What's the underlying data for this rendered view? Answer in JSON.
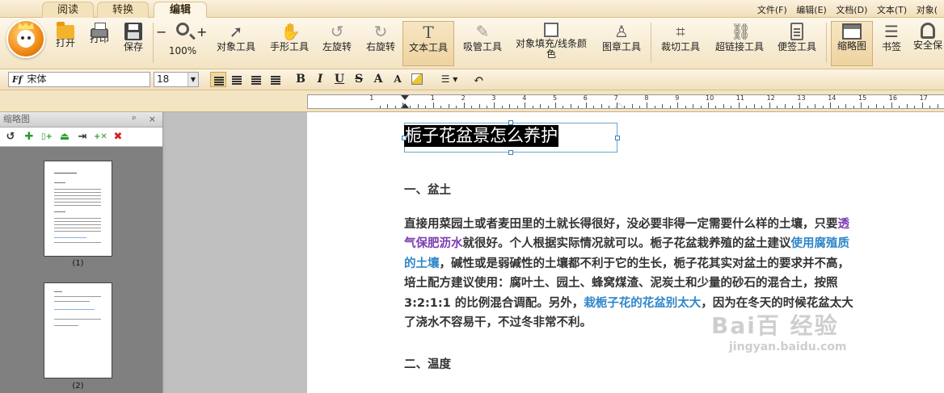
{
  "tabs": [
    {
      "label": "阅读"
    },
    {
      "label": "转换"
    },
    {
      "label": "编辑"
    }
  ],
  "menus": [
    "文件(F)",
    "编辑(E)",
    "文档(D)",
    "文本(T)",
    "对象("
  ],
  "ribbon": {
    "open": "打开",
    "print": "打印",
    "save": "保存",
    "zoom_minus": "−",
    "zoom_plus": "+",
    "zoom_level": "100%",
    "object_tool": "对象工具",
    "hand_tool": "手形工具",
    "rotate_left": "左旋转",
    "rotate_right": "右旋转",
    "text_tool": "文本工具",
    "eyedropper": "吸管工具",
    "fill_color": "对象填充/线条颜色",
    "stamp_tool": "图章工具",
    "crop_tool": "裁切工具",
    "link_tool": "超链接工具",
    "note_tool": "便签工具",
    "thumbnails": "缩略图",
    "bookmarks": "书签",
    "security": "安全保"
  },
  "format": {
    "font_prefix": "Ff",
    "font_name": "宋体",
    "font_size": "18",
    "bold": "B",
    "italic": "I",
    "underline": "U",
    "strike": "S",
    "superscript": "A",
    "subscript": "A"
  },
  "ruler_numbers": [
    "1",
    "1",
    "2",
    "3",
    "4",
    "5",
    "6",
    "7",
    "8",
    "9",
    "10",
    "11",
    "12",
    "13",
    "14",
    "15",
    "16",
    "17"
  ],
  "panel": {
    "title": "缩略图",
    "pages": [
      {
        "label": "(1)"
      },
      {
        "label": "(2)"
      }
    ]
  },
  "document": {
    "title": "栀子花盆景怎么养护",
    "heading1": "一、盆土",
    "p1_a": "直接用菜园土或者麦田里的土就长得很好，没必要非得一定需要什么样的土壤，只要",
    "p1_link1": "透气保肥沥水",
    "p1_b": "就很好。个人根据实际情况就可以。栀子花盆栽养殖的盆土建议",
    "p1_link2": "使用腐殖质的土壤",
    "p1_c": "，碱性或是弱碱性的土壤都不利于它的生长，栀子花其实对盆土的要求并不高，培土配方建议使用：腐叶土、园土、蜂窝煤渣、泥炭土和少量的砂石的混合土，按照 3:2:1:1 的比例混合调配。另外，",
    "p1_link3": "栽栀子花的花盆别太大",
    "p1_d": "，因为在冬天的时候花盆太大了浇水不容易干，不过冬非常不利。",
    "heading2": "二、温度"
  },
  "watermark": {
    "big": "Bai百 经验",
    "small": "jingyan.baidu.com"
  }
}
